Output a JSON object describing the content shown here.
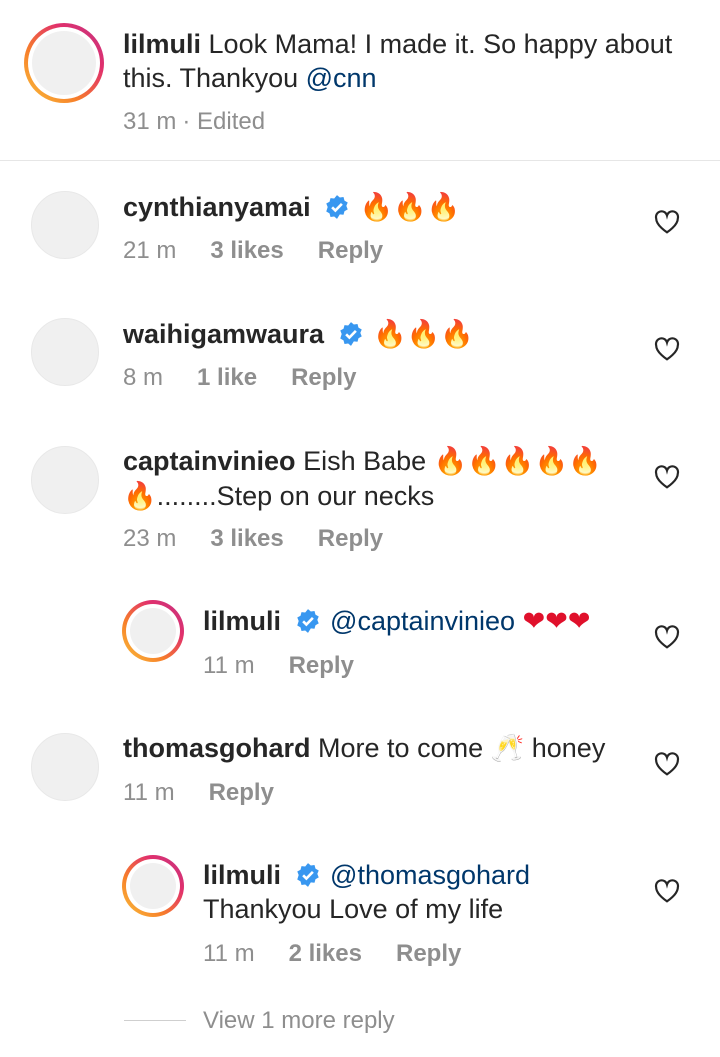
{
  "caption": {
    "username": "lilmuli",
    "text": "Look Mama! I made it. So happy about this. Thankyou",
    "mention": "@cnn",
    "time": "31 m",
    "edited": "· Edited"
  },
  "comments": [
    {
      "username": "cynthianyamai",
      "verified": true,
      "emoji": "🔥🔥🔥",
      "time": "21 m",
      "likes": "3 likes",
      "reply": "Reply"
    },
    {
      "username": "waihigamwaura",
      "verified": true,
      "emoji": "🔥🔥🔥",
      "time": "8 m",
      "likes": "1 like",
      "reply": "Reply"
    },
    {
      "username": "captainvinieo",
      "text_pre": "Eish Babe",
      "emoji": "🔥🔥🔥🔥🔥",
      "emoji2": "🔥",
      "text_post": "........Step on our necks",
      "time": "23 m",
      "likes": "3 likes",
      "reply": "Reply"
    },
    {
      "username": "lilmuli",
      "verified": true,
      "mention": "@captainvinieo",
      "emoji": "❤❤❤",
      "time": "11 m",
      "reply": "Reply"
    },
    {
      "username": "thomasgohard",
      "text_pre": "More to come",
      "emoji": "🥂",
      "text_post": "honey",
      "time": "11 m",
      "reply": "Reply"
    },
    {
      "username": "lilmuli",
      "verified": true,
      "mention": "@thomasgohard",
      "text": "Thankyou Love of my life",
      "time": "11 m",
      "likes": "2 likes",
      "reply": "Reply"
    }
  ],
  "view_more": "View 1 more reply",
  "colors": {
    "text": "#262626",
    "muted": "#8e8e8e",
    "mention": "#00376b",
    "verified": "#3897f0"
  }
}
